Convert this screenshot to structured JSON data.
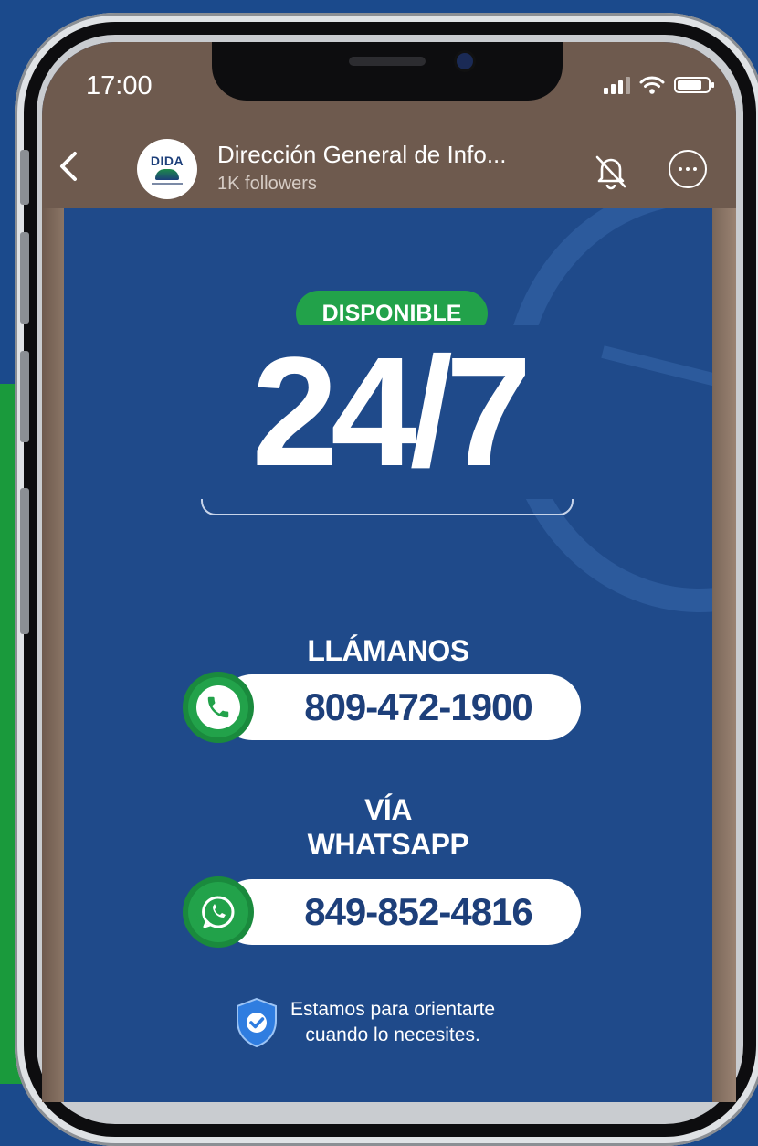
{
  "status_bar": {
    "time": "17:00"
  },
  "channel": {
    "logo_text": "DIDA",
    "name": "Dirección General de Info...",
    "followers": "1K followers"
  },
  "poster": {
    "badge": "DISPONIBLE",
    "availability": "24/7",
    "call_heading": "LLÁMANOS",
    "phone_number": "809-472-1900",
    "whatsapp_heading_line1": "VÍA",
    "whatsapp_heading_line2": "WHATSAPP",
    "whatsapp_number": "849-852-4816",
    "footer_line1": "Estamos para orientarte",
    "footer_line2": "cuando lo necesites."
  },
  "colors": {
    "poster_blue": "#1f4a8a",
    "accent_green": "#22a24a",
    "header_brown": "#6e5a4e",
    "number_navy": "#1d3f7a"
  },
  "icons": [
    "back-chevron-icon",
    "bell-muted-icon",
    "more-options-icon",
    "phone-icon",
    "whatsapp-icon",
    "shield-check-icon",
    "signal-icon",
    "wifi-icon",
    "battery-icon"
  ]
}
